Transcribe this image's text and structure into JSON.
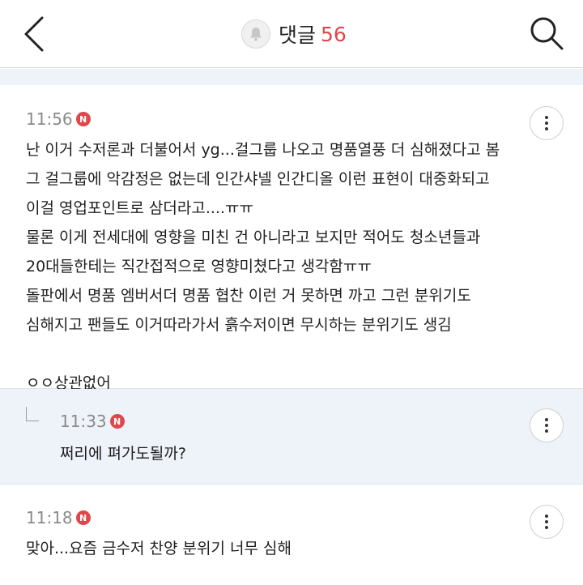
{
  "header": {
    "title": "댓글",
    "count": "56",
    "icons": {
      "back": "chevron-left-icon",
      "bell": "bell-icon",
      "search": "search-icon"
    }
  },
  "comments": [
    {
      "time": "11:56",
      "badge": "N",
      "lines": [
        "난 이거 수저론과 더불어서 yg...걸그룹 나오고 명품열풍 더 심해졌다고 봄",
        "그 걸그룹에 악감정은 없는데 인간샤넬 인간디올 이런 표현이 대중화되고",
        "이걸 영업포인트로 삼더라고....ㅠㅠ",
        "물론 이게 전세대에 영향을 미친 건 아니라고 보지만 적어도 청소년들과",
        "20대들한테는 직간접적으로 영향미쳤다고 생각함ㅠㅠ",
        "돌판에서 명품 엠버서더 명품 협찬 이런 거 못하면 까고 그런 분위기도",
        "심해지고 팬들도 이거따라가서 흙수저이면 무시하는 분위기도 생김",
        "",
        "ㅇㅇ상관없어"
      ]
    },
    {
      "time": "11:33",
      "badge": "N",
      "is_reply": true,
      "lines": [
        "쩌리에 펴가도될까?"
      ]
    },
    {
      "time": "11:18",
      "badge": "N",
      "lines": [
        "맞아...요즘 금수저 찬양 분위기 너무 심해"
      ]
    }
  ],
  "colors": {
    "accent": "#e0474c",
    "reply_bg": "#eef2f9"
  }
}
